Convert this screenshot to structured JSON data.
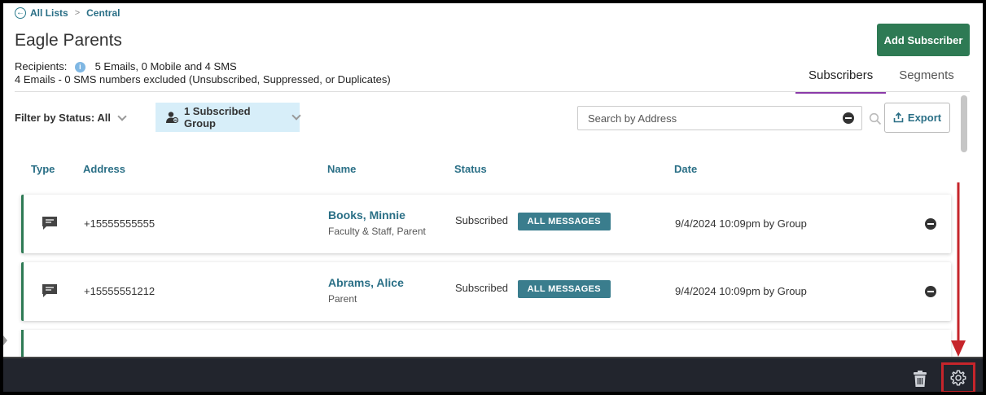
{
  "breadcrumb": {
    "back_label": "All Lists",
    "separator": ">",
    "current": "Central"
  },
  "page": {
    "title": "Eagle Parents",
    "recipients_label": "Recipients:",
    "recipients_summary": "5 Emails, 0 Mobile and 4 SMS",
    "excluded_summary": "4 Emails - 0 SMS numbers excluded (Unsubscribed, Suppressed, or Duplicates)"
  },
  "actions": {
    "add_subscriber": "Add Subscriber",
    "export": "Export"
  },
  "tabs": [
    {
      "label": "Subscribers",
      "active": true
    },
    {
      "label": "Segments",
      "active": false
    }
  ],
  "filters": {
    "status_label": "Filter by Status: All",
    "group_label": "1 Subscribed Group",
    "search_placeholder": "Search by Address"
  },
  "table": {
    "columns": [
      "Type",
      "Address",
      "Name",
      "Status",
      "Date"
    ],
    "rows": [
      {
        "type_icon": "chat-icon",
        "address": "+15555555555",
        "name": "Books, Minnie",
        "groups": "Faculty & Staff, Parent",
        "status": "Subscribed",
        "badge": "ALL MESSAGES",
        "date": "9/4/2024 10:09pm by Group"
      },
      {
        "type_icon": "chat-icon",
        "address": "+15555551212",
        "name": "Abrams, Alice",
        "groups": "Parent",
        "status": "Subscribed",
        "badge": "ALL MESSAGES",
        "date": "9/4/2024 10:09pm by Group"
      }
    ]
  },
  "footer": {
    "trash_icon": "trash-icon",
    "settings_icon": "gear-icon"
  },
  "colors": {
    "accent_green": "#2e7a54",
    "link_teal": "#2a6f86",
    "badge_teal": "#3a7d8d",
    "highlight_red": "#c6252b",
    "footer_bg": "#22252d",
    "tab_underline": "#8a3aa8"
  }
}
